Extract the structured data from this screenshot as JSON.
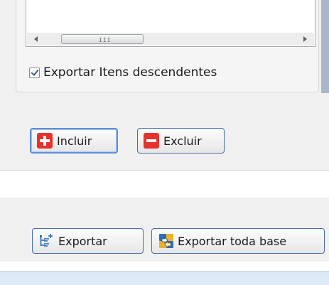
{
  "panel": {
    "checkbox_label": "Exportar Itens descendentes",
    "checkbox_checked": true
  },
  "buttons": {
    "incluir": "Incluir",
    "excluir": "Excluir",
    "exportar": "Exportar",
    "exportar_toda_base": "Exportar toda base"
  },
  "icons": {
    "incluir": "plus-icon",
    "excluir": "minus-icon",
    "exportar": "tree-add-icon",
    "exportar_toda_base": "database-export-icon"
  },
  "colors": {
    "accent_border": "#5d8ed8",
    "icon_red": "#e5322d",
    "panel_bg": "#f0f0f0"
  }
}
